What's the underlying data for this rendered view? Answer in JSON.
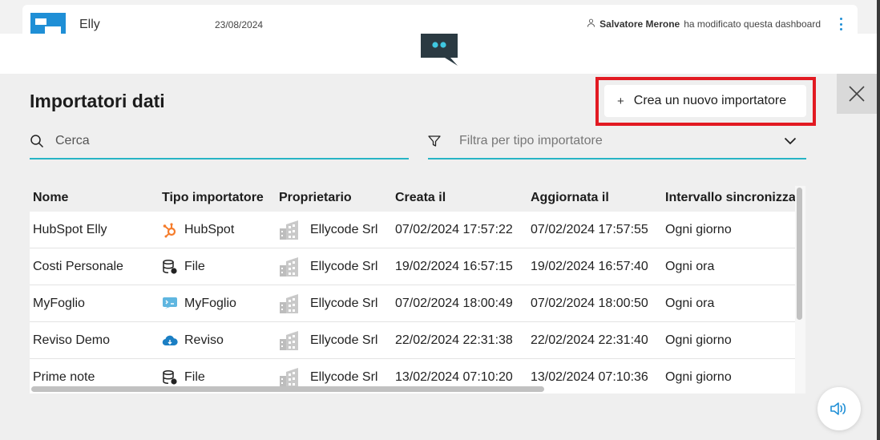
{
  "header": {
    "app_name": "Elly",
    "date": "23/08/2024",
    "user_name": "Salvatore Merone",
    "user_action": "ha modificato questa dashboard"
  },
  "modal": {
    "title": "Importatori dati",
    "create_button_label": "Crea un nuovo importatore",
    "search_placeholder": "Cerca",
    "filter_placeholder": "Filtra per tipo importatore"
  },
  "table": {
    "columns": [
      "Nome",
      "Tipo importatore",
      "Proprietario",
      "Creata il",
      "Aggiornata il",
      "Intervallo sincronizza"
    ],
    "rows": [
      {
        "name": "HubSpot Elly",
        "type": "HubSpot",
        "type_icon": "hubspot-icon",
        "owner": "Ellycode Srl",
        "created": "07/02/2024 17:57:22",
        "updated": "07/02/2024 17:57:55",
        "interval": "Ogni giorno"
      },
      {
        "name": "Costi Personale",
        "type": "File",
        "type_icon": "database-file-icon",
        "owner": "Ellycode Srl",
        "created": "19/02/2024 16:57:15",
        "updated": "19/02/2024 16:57:40",
        "interval": "Ogni ora"
      },
      {
        "name": "MyFoglio",
        "type": "MyFoglio",
        "type_icon": "myfoglio-icon",
        "owner": "Ellycode Srl",
        "created": "07/02/2024 18:00:49",
        "updated": "07/02/2024 18:00:50",
        "interval": "Ogni ora"
      },
      {
        "name": "Reviso Demo",
        "type": "Reviso",
        "type_icon": "cloud-icon",
        "owner": "Ellycode Srl",
        "created": "22/02/2024 22:31:38",
        "updated": "22/02/2024 22:31:40",
        "interval": "Ogni giorno"
      },
      {
        "name": "Prime note",
        "type": "File",
        "type_icon": "database-file-icon",
        "owner": "Ellycode Srl",
        "created": "13/02/2024 07:10:20",
        "updated": "13/02/2024 07:10:36",
        "interval": "Ogni giorno"
      }
    ]
  },
  "colors": {
    "accent": "#27b4c5",
    "brand_blue": "#1f8fd6",
    "highlight_red": "#e21a22",
    "hubspot_orange": "#f57c2b"
  }
}
